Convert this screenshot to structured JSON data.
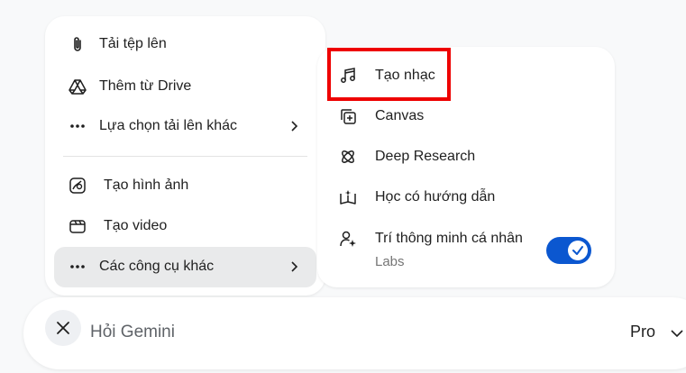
{
  "left_menu": {
    "items": [
      {
        "label": "Tải tệp lên",
        "icon": "paperclip-icon"
      },
      {
        "label": "Thêm từ Drive",
        "icon": "google-drive-icon"
      },
      {
        "label": "Lựa chọn tải lên khác",
        "icon": "more-horiz-icon"
      },
      {
        "label": "Tạo hình ảnh",
        "icon": "image-spark-icon"
      },
      {
        "label": "Tạo video",
        "icon": "video-clapper-icon"
      },
      {
        "label": "Các công cụ khác",
        "icon": "more-horiz-icon"
      }
    ]
  },
  "right_menu": {
    "items": [
      {
        "label": "Tạo nhạc",
        "icon": "music-note-icon"
      },
      {
        "label": "Canvas",
        "icon": "canvas-icon"
      },
      {
        "label": "Deep Research",
        "icon": "deep-research-icon"
      },
      {
        "label": "Học có hướng dẫn",
        "icon": "guided-learning-icon"
      },
      {
        "label": "Trí thông minh cá nhân",
        "sublabel": "Labs",
        "icon": "person-spark-icon",
        "toggle_on": true
      }
    ]
  },
  "input_bar": {
    "placeholder": "Hỏi Gemini",
    "model": "Pro"
  },
  "colors": {
    "toggle": "#0b57d0",
    "highlight": "#ee0000",
    "hover": "#e9eaeb"
  }
}
